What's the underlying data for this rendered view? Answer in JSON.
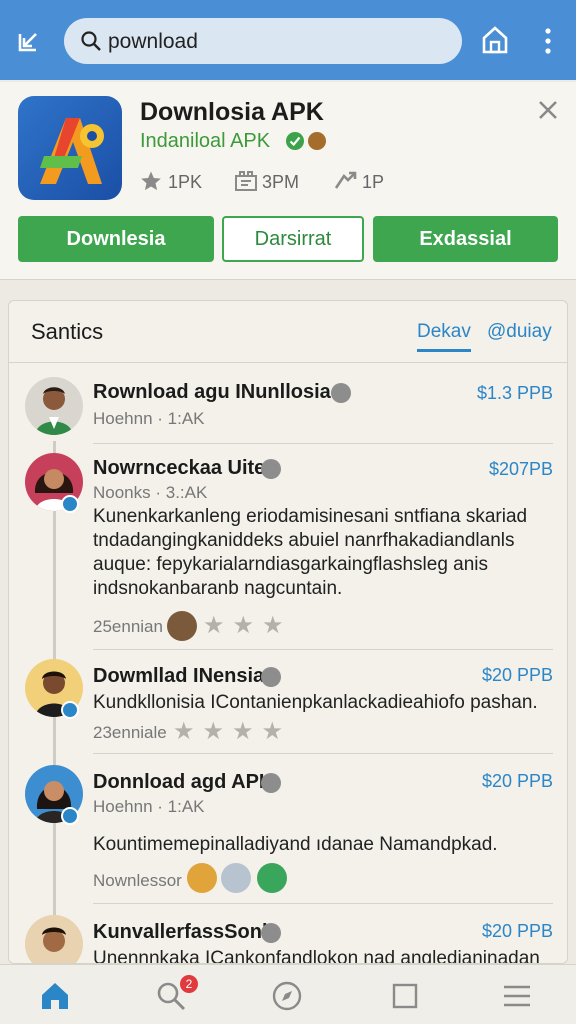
{
  "topbar": {
    "search_value": "pownload",
    "icons": [
      "back-icon",
      "search-icon",
      "home-icon",
      "more-vertical-icon"
    ]
  },
  "app": {
    "name": "Downlosia APK",
    "subtitle": "Indaniloal APK",
    "stats": [
      {
        "icon": "star-icon",
        "value": "1PK"
      },
      {
        "icon": "reviews-icon",
        "value": "3PM"
      },
      {
        "icon": "download-icon",
        "value": "1P"
      }
    ],
    "buttons": {
      "primary": "Downlesia",
      "secondary": "Darsirrat",
      "tertiary": "Exdassial"
    },
    "colors": {
      "accent": "#3ea64f",
      "link": "#2b86c7",
      "topbar": "#4a8fd6"
    }
  },
  "reviews": {
    "title": "Santics",
    "tabs": [
      "Dekav",
      "@duiay"
    ],
    "items": [
      {
        "name": "Rownload agu INunllosia",
        "meta": "Hoehnn · 1:AK",
        "price": "$1.3 PPB",
        "text": "",
        "foot": ""
      },
      {
        "name": "Nowrnceckaa Uite",
        "meta": "Noonks · 3.:AK",
        "price": "$207PB",
        "text": "Kunenkarkanleng eriodamisinesani sntfiana skariad tndadangingkaniddeks abuiel nanrfhakadiandlanls auque: fepykarialarndiasgarkaingflashsleg anis indsnokanbaranb nagcuntain.",
        "foot": "25ennian",
        "rating": 0
      },
      {
        "name": "Dowmllad INensia",
        "meta": "",
        "price": "$20 PPB",
        "text": "Kundkllonisia IContanienpkanlackadieahiofo pashan.",
        "foot": "23enniale",
        "rating": 0
      },
      {
        "name": "Donnload agd APK",
        "meta": "Hoehnn · 1:AK",
        "price": "$20 PPB",
        "text": "Kountimemepinalladiyand ıdanae Namandpkad.",
        "foot": "Nownlessor"
      },
      {
        "name": "KunvallerfassSonk",
        "meta": "",
        "price": "$20 PPB",
        "text": "Unennnkaka ICankonfandlokon nad angledianinadan",
        "foot": ""
      }
    ]
  },
  "bottomnav": {
    "items": [
      "home-icon",
      "search-icon",
      "explore-icon",
      "square-icon",
      "menu-icon"
    ],
    "search_badge": "2"
  }
}
